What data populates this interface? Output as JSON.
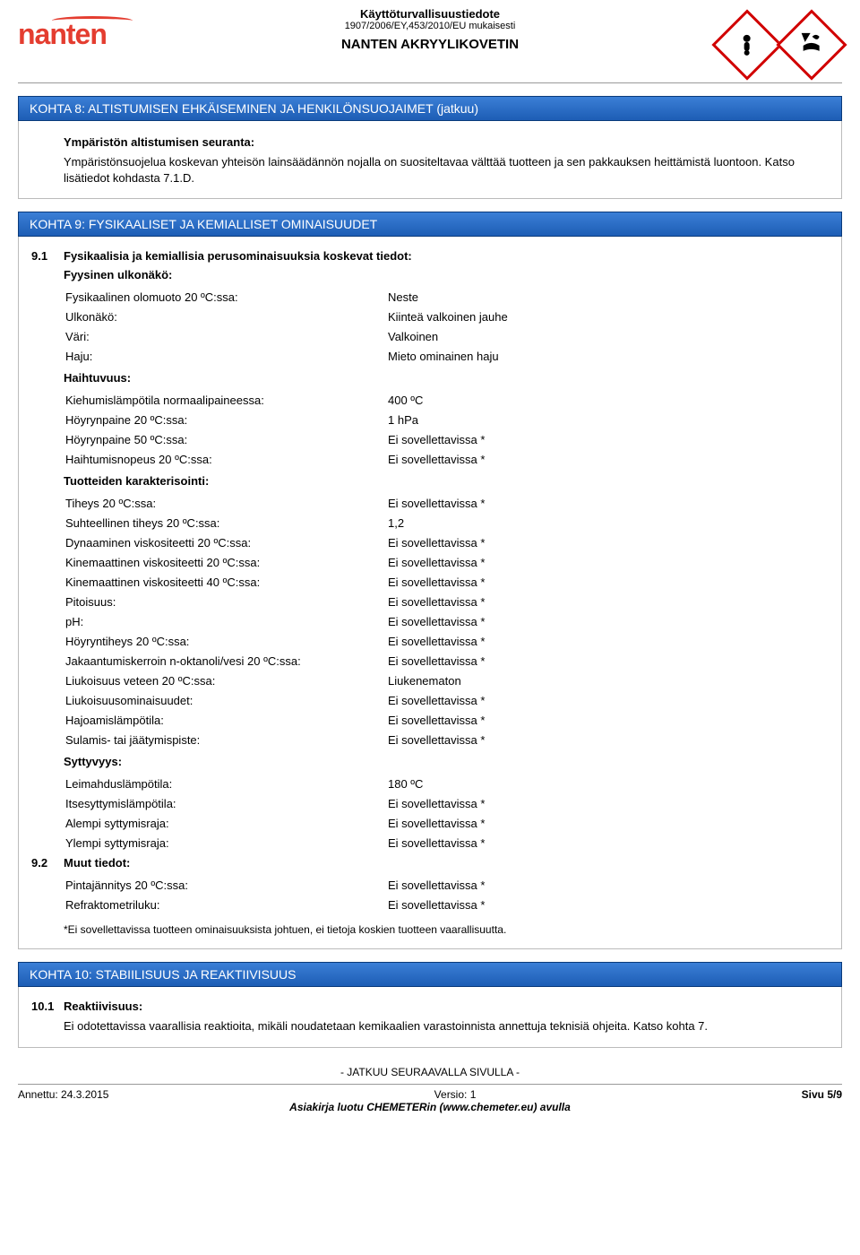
{
  "header": {
    "doc_type": "Käyttöturvallisuustiedote",
    "regulation": "1907/2006/EY,453/2010/EU mukaisesti",
    "product_name": "NANTEN AKRYYLIKOVETIN",
    "logo_text": "nanten",
    "hazard_icons": [
      "exclamation",
      "environment"
    ]
  },
  "section8": {
    "title": "KOHTA 8: ALTISTUMISEN EHKÄISEMINEN JA HENKILÖNSUOJAIMET (jatkuu)",
    "sub_heading": "Ympäristön altistumisen seuranta:",
    "body": "Ympäristönsuojelua koskevan yhteisön lainsäädännön nojalla on suositeltavaa välttää tuotteen ja sen pakkauksen heittämistä luontoon. Katso lisätiedot kohdasta 7.1.D."
  },
  "section9": {
    "title": "KOHTA 9: FYSIKAALISET JA KEMIALLISET OMINAISUUDET",
    "sub91_num": "9.1",
    "sub91_title": "Fysikaalisia ja kemiallisia perusominaisuuksia koskevat tiedot:",
    "sub91_h1": "Fyysinen ulkonäkö:",
    "props1": [
      {
        "k": "Fysikaalinen olomuoto 20 ºC:ssa:",
        "v": "Neste",
        "b": false
      },
      {
        "k": "Ulkonäkö:",
        "v": "Kiinteä valkoinen jauhe",
        "b": false
      },
      {
        "k": "Väri:",
        "v": "Valkoinen",
        "b": false
      },
      {
        "k": "Haju:",
        "v": "Mieto ominainen haju",
        "b": false
      }
    ],
    "h_volatility": "Haihtuvuus:",
    "props_vol": [
      {
        "k": "Kiehumislämpötila normaalipaineessa:",
        "v": "400 ºC"
      },
      {
        "k": "Höyrynpaine 20 ºC:ssa:",
        "v": "1 hPa"
      },
      {
        "k": "Höyrynpaine 50 ºC:ssa:",
        "v": "Ei sovellettavissa *"
      },
      {
        "k": "Haihtumisnopeus 20 ºC:ssa:",
        "v": "Ei sovellettavissa *"
      }
    ],
    "h_char": "Tuotteiden karakterisointi:",
    "props_char": [
      {
        "k": "Tiheys 20 ºC:ssa:",
        "v": "Ei sovellettavissa *"
      },
      {
        "k": "Suhteellinen tiheys 20 ºC:ssa:",
        "v": "1,2"
      },
      {
        "k": "Dynaaminen viskositeetti 20 ºC:ssa:",
        "v": "Ei sovellettavissa *"
      },
      {
        "k": "Kinemaattinen viskositeetti 20 ºC:ssa:",
        "v": "Ei sovellettavissa *"
      },
      {
        "k": "Kinemaattinen viskositeetti 40 ºC:ssa:",
        "v": "Ei sovellettavissa *"
      },
      {
        "k": "Pitoisuus:",
        "v": "Ei sovellettavissa *"
      },
      {
        "k": "pH:",
        "v": "Ei sovellettavissa *"
      },
      {
        "k": "Höyryntiheys 20 ºC:ssa:",
        "v": "Ei sovellettavissa *"
      },
      {
        "k": "Jakaantumiskerroin n-oktanoli/vesi 20 ºC:ssa:",
        "v": "Ei sovellettavissa *"
      },
      {
        "k": "Liukoisuus veteen 20 ºC:ssa:",
        "v": "Liukenematon"
      },
      {
        "k": "Liukoisuusominaisuudet:",
        "v": "Ei sovellettavissa *"
      },
      {
        "k": "Hajoamislämpötila:",
        "v": "Ei sovellettavissa *"
      },
      {
        "k": "Sulamis- tai jäätymispiste:",
        "v": "Ei sovellettavissa *"
      }
    ],
    "h_flam": "Syttyvyys:",
    "props_flam": [
      {
        "k": "Leimahduslämpötila:",
        "v": "180 ºC"
      },
      {
        "k": "Itsesyttymislämpötila:",
        "v": "Ei sovellettavissa *"
      },
      {
        "k": "Alempi syttymisraja:",
        "v": "Ei sovellettavissa *"
      },
      {
        "k": "Ylempi syttymisraja:",
        "v": "Ei sovellettavissa *"
      }
    ],
    "sub92_num": "9.2",
    "sub92_title": "Muut tiedot:",
    "props_other": [
      {
        "k": "Pintajännitys 20 ºC:ssa:",
        "v": "Ei sovellettavissa *"
      },
      {
        "k": "Refraktometriluku:",
        "v": "Ei sovellettavissa *"
      }
    ],
    "footnote": "*Ei sovellettavissa tuotteen ominaisuuksista johtuen, ei tietoja koskien tuotteen vaarallisuutta."
  },
  "section10": {
    "title": "KOHTA 10: STABIILISUUS JA REAKTIIVISUUS",
    "sub_num": "10.1",
    "sub_title": "Reaktiivisuus:",
    "body": "Ei odotettavissa vaarallisia reaktioita, mikäli noudatetaan kemikaalien varastoinnista annettuja teknisiä ohjeita. Katso kohta 7."
  },
  "footer": {
    "continues": "- JATKUU SEURAAVALLA SIVULLA -",
    "issued_label": "Annettu: ",
    "issued_date": "24.3.2015",
    "version_label": "Versio: ",
    "version": "1",
    "page_label": "Sivu ",
    "page": "5/9",
    "generator": "Asiakirja luotu CHEMETERin (www.chemeter.eu) avulla"
  }
}
